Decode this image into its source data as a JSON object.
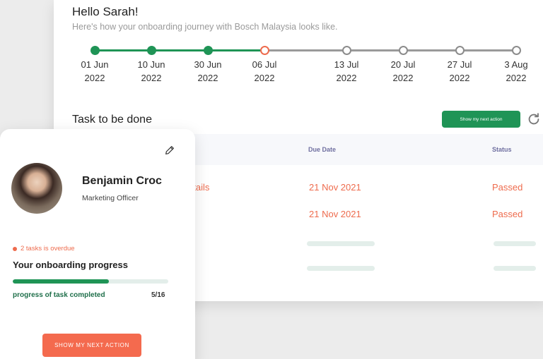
{
  "header": {
    "greeting": "Hello Sarah!",
    "subtitle": "Here's how your onboarding journey with Bosch Malaysia looks like."
  },
  "timeline": [
    {
      "date": "01 Jun",
      "year": "2022",
      "state": "done"
    },
    {
      "date": "10 Jun",
      "year": "2022",
      "state": "done"
    },
    {
      "date": "30 Jun",
      "year": "2022",
      "state": "done"
    },
    {
      "date": "06 Jul",
      "year": "2022",
      "state": "current"
    },
    {
      "date": "13 Jul",
      "year": "2022",
      "state": "future"
    },
    {
      "date": "20 Jul",
      "year": "2022",
      "state": "future"
    },
    {
      "date": "27 Jul",
      "year": "2022",
      "state": "future"
    },
    {
      "date": "3 Aug",
      "year": "2022",
      "state": "future"
    }
  ],
  "tasks": {
    "title": "Task to be done",
    "next_action_label": "Show my next action",
    "columns": {
      "due": "Due Date",
      "status": "Status"
    },
    "rows": [
      {
        "name_fragment": "etails",
        "due": "21 Nov 2021",
        "status": "Passed"
      },
      {
        "name_fragment": "",
        "due": "21 Nov 2021",
        "status": "Passed"
      }
    ]
  },
  "profile": {
    "name": "Benjamin Croc",
    "role": "Marketing Officer",
    "overdue": "2 tasks is overdue",
    "progress_title": "Your onboarding progress",
    "progress_label": "progress of task completed",
    "progress_count": "5/16",
    "progress_fraction": 0.62,
    "action_label": "SHOW MY NEXT ACTION"
  },
  "colors": {
    "accent_green": "#1f9456",
    "accent_orange": "#ee6b4d"
  },
  "icons": {
    "refresh": "refresh-icon",
    "edit": "pencil-icon"
  }
}
